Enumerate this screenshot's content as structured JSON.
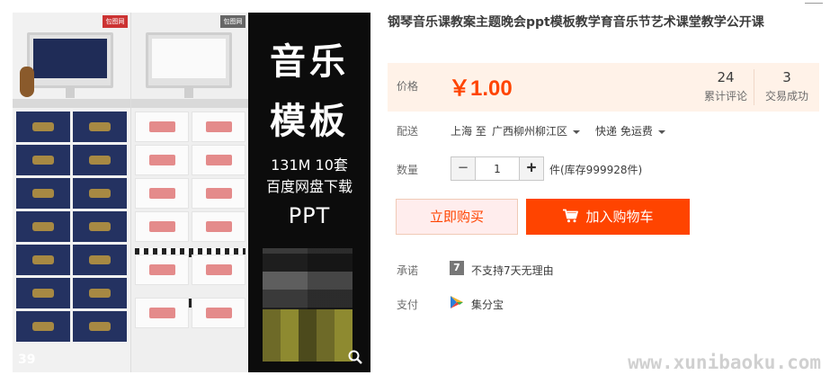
{
  "product": {
    "title": "钢琴音乐课教案主题晚会ppt模板教学育音乐节艺术课堂教学公开课",
    "image": {
      "count_badge": "39",
      "logo_text": "包图网",
      "promo_lines": [
        "音乐",
        "模板",
        "131M  10套",
        "百度网盘下载",
        "PPT"
      ]
    }
  },
  "price": {
    "label": "价格",
    "value": "￥1.00",
    "reviews_count": "24",
    "reviews_label": "累计评论",
    "deals_count": "3",
    "deals_label": "交易成功"
  },
  "shipping": {
    "label": "配送",
    "from": "上海 至",
    "to": "广西柳州柳江区",
    "method": "快递 免运费"
  },
  "quantity": {
    "label": "数量",
    "value": "1",
    "minus": "−",
    "plus": "+",
    "stock": "件(库存999928件)"
  },
  "actions": {
    "buy_now": "立即购买",
    "add_to_cart": "加入购物车"
  },
  "promise": {
    "label": "承诺",
    "icon_glyph": "7",
    "text": "不支持7天无理由"
  },
  "payment": {
    "label": "支付",
    "text": "集分宝"
  },
  "watermark": "www.xunibaoku.com",
  "colors": {
    "accent": "#ff4400",
    "price_bg": "#fff2e8",
    "buy_now_bg": "#ffeded"
  }
}
